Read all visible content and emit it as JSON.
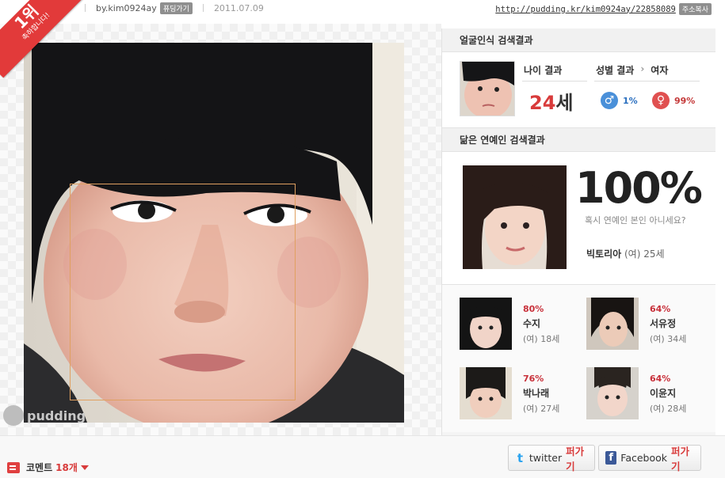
{
  "ribbon": {
    "rank": "1위",
    "congrats": "축하합니다!"
  },
  "header": {
    "author": "by.kim0924ay",
    "follow_label": "퓨딩가기",
    "date": "2011.07.09",
    "url": "http://pudding.kr/kim0924ay/22858089",
    "copy_label": "주소복사"
  },
  "photo": {
    "watermark": "pudding"
  },
  "face_result": {
    "heading": "얼굴인식 검색결과",
    "age_label": "나이 결과",
    "age_value": "24",
    "age_unit": "세",
    "gender_label": "성별 결과",
    "gender_arrow": "›",
    "gender_value": "여자",
    "male_symbol": "♂",
    "male_pct": "1%",
    "female_symbol": "♀",
    "female_pct": "99%"
  },
  "celebrity": {
    "heading": "닮은 연예인 검색결과",
    "top": {
      "pct": "100%",
      "question": "혹시 연예인 본인 아니세요?",
      "name": "빅토리아",
      "info": "(여) 25세"
    },
    "others": [
      {
        "pct": "80%",
        "name": "수지",
        "info": "(여) 18세"
      },
      {
        "pct": "64%",
        "name": "서유정",
        "info": "(여) 34세"
      },
      {
        "pct": "76%",
        "name": "박나래",
        "info": "(여) 27세"
      },
      {
        "pct": "64%",
        "name": "이윤지",
        "info": "(여) 28세"
      }
    ]
  },
  "footer": {
    "comment_label": "코멘트",
    "comment_count": "18개",
    "twitter_label": "twitter",
    "facebook_label": "Facebook",
    "spread_label": "퍼가기"
  },
  "colors": {
    "accent": "#d83b3b",
    "ribbon": "#e23a3a",
    "male": "#4a90d9",
    "female": "#e05050",
    "facebook": "#3b5998",
    "twitter": "#2aa3ef"
  }
}
